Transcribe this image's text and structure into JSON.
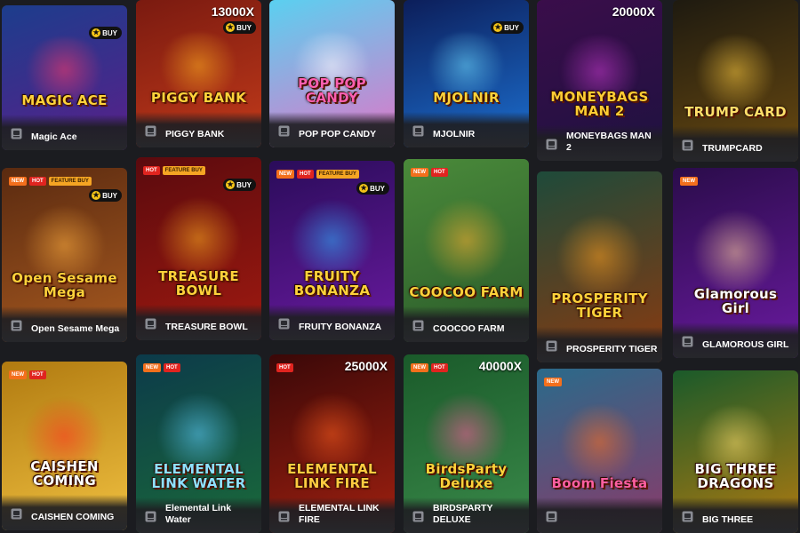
{
  "games": [
    {
      "name": "Magic Ace",
      "logo": "MAGIC ACE",
      "multiplier": "",
      "buy": "BUY",
      "tags": [],
      "colors": {
        "bg1": "#1c3d8c",
        "bg2": "#5a1f8a",
        "glow": "#ff3a6a",
        "logo": "#ffd23a"
      }
    },
    {
      "name": "PIGGY BANK",
      "logo": "PIGGY BANK",
      "multiplier": "13000X",
      "buy": "BUY",
      "tags": [],
      "colors": {
        "bg1": "#7a1a10",
        "bg2": "#c23a1a",
        "glow": "#ffb020",
        "logo": "#ffd23a"
      }
    },
    {
      "name": "POP POP CANDY",
      "logo": "POP POP CANDY",
      "multiplier": "",
      "buy": "",
      "tags": [],
      "colors": {
        "bg1": "#5ad0f0",
        "bg2": "#e076c8",
        "glow": "#ffffff",
        "logo": "#ff5fb0"
      }
    },
    {
      "name": "MJOLNIR",
      "logo": "MJOLNIR",
      "multiplier": "",
      "buy": "BUY",
      "tags": [],
      "colors": {
        "bg1": "#0c1e5a",
        "bg2": "#1c6fd0",
        "glow": "#6fdcff",
        "logo": "#ffd23a"
      }
    },
    {
      "name": "MONEYBAGS MAN 2",
      "logo": "MONEYBAGS MAN 2",
      "multiplier": "20000X",
      "buy": "",
      "tags": [],
      "colors": {
        "bg1": "#3a0d4a",
        "bg2": "#1e1240",
        "glow": "#c93ad0",
        "logo": "#ffcc33"
      }
    },
    {
      "name": "TRUMPCARD",
      "logo": "TRUMP CARD",
      "multiplier": "",
      "buy": "",
      "tags": [],
      "colors": {
        "bg1": "#1e1a10",
        "bg2": "#6a4a10",
        "glow": "#ffcc40",
        "logo": "#ffdf6a"
      }
    },
    {
      "name": "Open Sesame Mega",
      "logo": "Open Sesame Mega",
      "multiplier": "",
      "buy": "BUY",
      "tags": [
        "NEW",
        "HOT",
        "FEATURE BUY"
      ],
      "colors": {
        "bg1": "#5a2a10",
        "bg2": "#a85a20",
        "glow": "#ffb040",
        "logo": "#ffd23a"
      }
    },
    {
      "name": "TREASURE BOWL",
      "logo": "TREASURE BOWL",
      "multiplier": "",
      "buy": "BUY",
      "tags": [
        "HOT",
        "FEATURE BUY"
      ],
      "colors": {
        "bg1": "#5a0a0e",
        "bg2": "#a01a10",
        "glow": "#ffb020",
        "logo": "#ffd23a"
      }
    },
    {
      "name": "FRUITY BONANZA",
      "logo": "FRUITY BONANZA",
      "multiplier": "",
      "buy": "BUY",
      "tags": [
        "NEW",
        "HOT",
        "FEATURE BUY"
      ],
      "colors": {
        "bg1": "#2a0c5a",
        "bg2": "#6a1aa0",
        "glow": "#30b0ff",
        "logo": "#ffd23a"
      }
    },
    {
      "name": "COOCOO FARM",
      "logo": "COOCOO FARM",
      "multiplier": "",
      "buy": "",
      "tags": [
        "NEW",
        "HOT"
      ],
      "colors": {
        "bg1": "#4a8a3a",
        "bg2": "#2a5a2a",
        "glow": "#ffb030",
        "logo": "#ffd23a"
      }
    },
    {
      "name": "PROSPERITY TIGER",
      "logo": "PROSPERITY TIGER",
      "multiplier": "",
      "buy": "",
      "tags": [],
      "colors": {
        "bg1": "#1e4a3a",
        "bg2": "#8a3a10",
        "glow": "#ffa020",
        "logo": "#ffd23a"
      }
    },
    {
      "name": "GLAMOROUS GIRL",
      "logo": "Glamorous Girl",
      "multiplier": "",
      "buy": "",
      "tags": [
        "NEW"
      ],
      "colors": {
        "bg1": "#2a0c4a",
        "bg2": "#6a1aa0",
        "glow": "#ffd0a0",
        "logo": "#ffffff"
      }
    },
    {
      "name": "CAISHEN COMING",
      "logo": "CAISHEN COMING",
      "multiplier": "",
      "buy": "",
      "tags": [
        "NEW",
        "HOT"
      ],
      "colors": {
        "bg1": "#b07a10",
        "bg2": "#f0c040",
        "glow": "#ff3020",
        "logo": "#ffffff"
      }
    },
    {
      "name": "Elemental Link Water",
      "logo": "ELEMENTAL LINK WATER",
      "multiplier": "",
      "buy": "",
      "tags": [
        "NEW",
        "HOT"
      ],
      "colors": {
        "bg1": "#0c3a4a",
        "bg2": "#1a6a3a",
        "glow": "#60d0ff",
        "logo": "#8fe0ff"
      }
    },
    {
      "name": "ELEMENTAL LINK FIRE",
      "logo": "ELEMENTAL LINK FIRE",
      "multiplier": "25000X",
      "buy": "",
      "tags": [
        "HOT"
      ],
      "colors": {
        "bg1": "#3a0808",
        "bg2": "#a02010",
        "glow": "#ff6020",
        "logo": "#ffcc40"
      }
    },
    {
      "name": "BIRDSPARTY DELUXE",
      "logo": "BirdsParty Deluxe",
      "multiplier": "40000X",
      "buy": "",
      "tags": [
        "NEW",
        "HOT"
      ],
      "colors": {
        "bg1": "#1a5a2a",
        "bg2": "#3a8a4a",
        "glow": "#ff5aa0",
        "logo": "#ffd23a"
      }
    },
    {
      "name": "",
      "logo": "Boom Fiesta",
      "multiplier": "",
      "buy": "",
      "tags": [
        "NEW"
      ],
      "colors": {
        "bg1": "#2a6a8a",
        "bg2": "#8a3a6a",
        "glow": "#ff7020",
        "logo": "#ff5fa0"
      }
    },
    {
      "name": "BIG THREE",
      "logo": "BIG THREE DRAGONS",
      "multiplier": "",
      "buy": "",
      "tags": [],
      "colors": {
        "bg1": "#1a5a2a",
        "bg2": "#b07a10",
        "glow": "#ffe070",
        "logo": "#ffffff"
      }
    }
  ]
}
